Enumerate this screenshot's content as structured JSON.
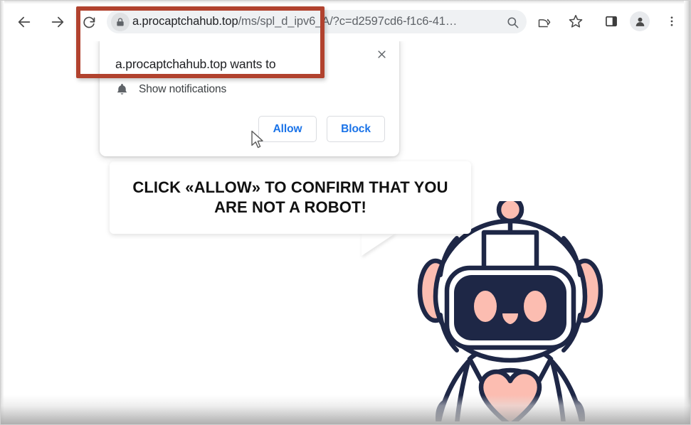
{
  "browser": {
    "nav": {
      "back_icon": "arrow-left-icon",
      "forward_icon": "arrow-right-icon",
      "reload_icon": "reload-icon"
    },
    "omnibox": {
      "lock_icon": "lock-icon",
      "url_host": "a.procaptchahub.top",
      "url_path": "/ms/spl_d_ipv6_A/?c=d2597cd6-f1c6-41…",
      "url_full": "a.procaptchahub.top/ms/spl_d_ipv6_A/?c=d2597cd6-f1c6-41…",
      "search_icon": "search-icon"
    },
    "toolbar_icons": {
      "share": "share-icon",
      "bookmark": "star-icon",
      "side_panel": "side-panel-icon",
      "profile": "profile-avatar-icon",
      "menu": "three-dot-menu-icon"
    }
  },
  "permission_dialog": {
    "title": "a.procaptchahub.top wants to",
    "close_icon": "close-icon",
    "option": {
      "icon": "bell-icon",
      "label": "Show notifications"
    },
    "allow_label": "Allow",
    "block_label": "Block"
  },
  "speech_bubble": {
    "line1": "CLICK «ALLOW» TO CONFIRM THAT YOU",
    "line2": "ARE NOT A ROBOT!"
  },
  "robot": {
    "name": "robot-mascot",
    "colors": {
      "outline": "#1e2746",
      "accent_pink": "#fcbdb1",
      "visor": "#1e2746",
      "body": "#ffffff"
    }
  },
  "annotation": {
    "name": "red-highlight-box",
    "color": "#b1422e"
  },
  "cursor": {
    "name": "mouse-pointer"
  }
}
